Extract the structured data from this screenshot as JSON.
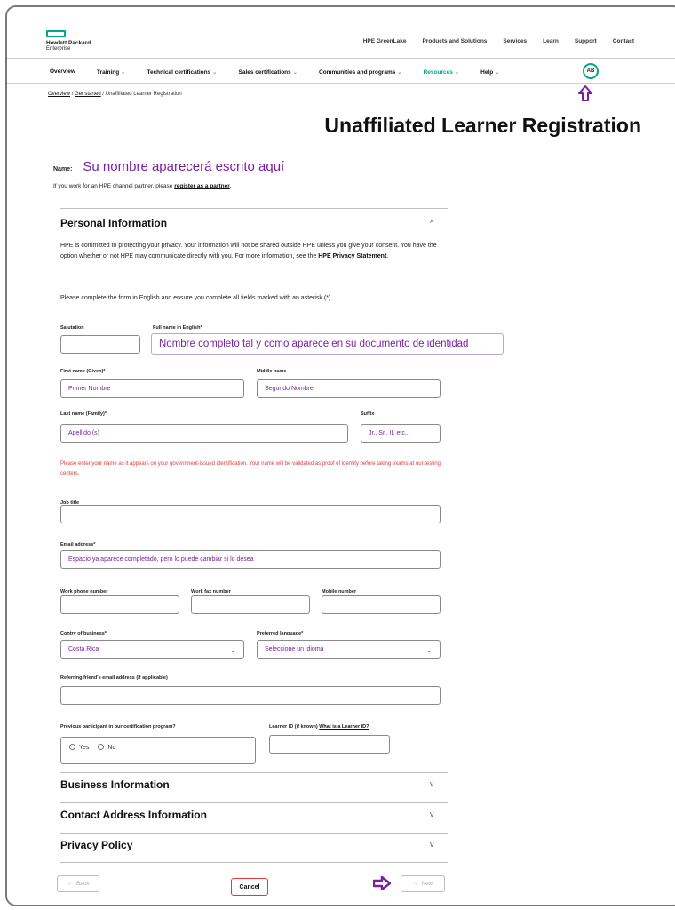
{
  "brand": {
    "line1": "Hewlett Packard",
    "line2": "Enterprise",
    "accent": "#01a982"
  },
  "util_nav": [
    "HPE GreenLake",
    "Products and Solutions",
    "Services",
    "Learn",
    "Support",
    "Contact"
  ],
  "main_nav": {
    "items": [
      {
        "label": "Overview",
        "dropdown": false
      },
      {
        "label": "Training",
        "dropdown": true
      },
      {
        "label": "Technical certifications",
        "dropdown": true
      },
      {
        "label": "Sales certifications",
        "dropdown": true
      },
      {
        "label": "Communities and programs",
        "dropdown": true
      },
      {
        "label": "Resources",
        "dropdown": true
      },
      {
        "label": "Help",
        "dropdown": true
      }
    ],
    "avatar": "AB"
  },
  "breadcrumb": {
    "overview": "Overview",
    "get_started": "Get started",
    "current": "Unaffiliated Learner Registration",
    "sep": "/"
  },
  "title": "Unaffiliated Learner Registration",
  "name_row": {
    "label": "Name:",
    "annotation": "Su nombre aparecerá escrito aquí"
  },
  "partner": {
    "prefix": "If you work for an HPE channel partner, please ",
    "link": "register as a partner",
    "suffix": "."
  },
  "personal": {
    "title": "Personal Information",
    "chevron": "^",
    "privacy_text": "HPE is committed to protecting your privacy. Your information will not be shared outside HPE unless you give your consent. You have the option whether or not HPE may communicate directly with you. For more information, see the ",
    "privacy_link": "HPE Privacy Statement",
    "privacy_end": ".",
    "instructions": "Please complete the form in English and ensure you complete all fields marked with an asterisk (*).",
    "fields": {
      "salutation": {
        "label": "Salutation",
        "value": ""
      },
      "full_name": {
        "label": "Full name in English*",
        "value": "Nombre completo tal y como aparece en su documento de identidad"
      },
      "first_name": {
        "label": "First name (Given)*",
        "value": "Primer Nombre"
      },
      "middle_name": {
        "label": "Middle name",
        "value": "Segundo Nombre"
      },
      "last_name": {
        "label": "Last name (Family)*",
        "value": "Apellido (s)"
      },
      "suffix": {
        "label": "Suffix",
        "value": "Jr., Sr., II, etc..."
      },
      "job_title": {
        "label": "Job title",
        "value": ""
      },
      "email": {
        "label": "Email address*",
        "value": "Espacio ya aparece completado, pero lo puede cambiar si lo desea"
      },
      "work_phone": {
        "label": "Work phone number",
        "value": ""
      },
      "work_fax": {
        "label": "Work fax number",
        "value": ""
      },
      "mobile": {
        "label": "Mobile number",
        "value": ""
      },
      "country": {
        "label": "Contry of business*",
        "value": "Costa Rica"
      },
      "language": {
        "label": "Preferred language*",
        "value": "Seleccione un idioma"
      },
      "referring": {
        "label": "Referring friend's email address (if applicable)",
        "value": ""
      },
      "previous": {
        "label": "Previous participant in our certification program?",
        "yes": "Yes",
        "no": "No"
      },
      "learner_id": {
        "label": "Learner ID (if known)",
        "link": "What is a Learner ID?",
        "value": ""
      }
    },
    "warning": "Please enter your name as it appears on your government-issued identification. Your name will be validated as proof of identity before taking exams at our testing centers."
  },
  "sections": [
    {
      "title": "Business Information",
      "chevron": "v"
    },
    {
      "title": "Contact Address Information",
      "chevron": "v"
    },
    {
      "title": "Privacy Policy",
      "chevron": "v"
    }
  ],
  "footer": {
    "back": "Back",
    "cancel": "Cancel",
    "next": "Next"
  },
  "colors": {
    "annotation": "#7b1fa2",
    "warning": "#e23a3a",
    "cancel_border": "#e23a3a"
  }
}
